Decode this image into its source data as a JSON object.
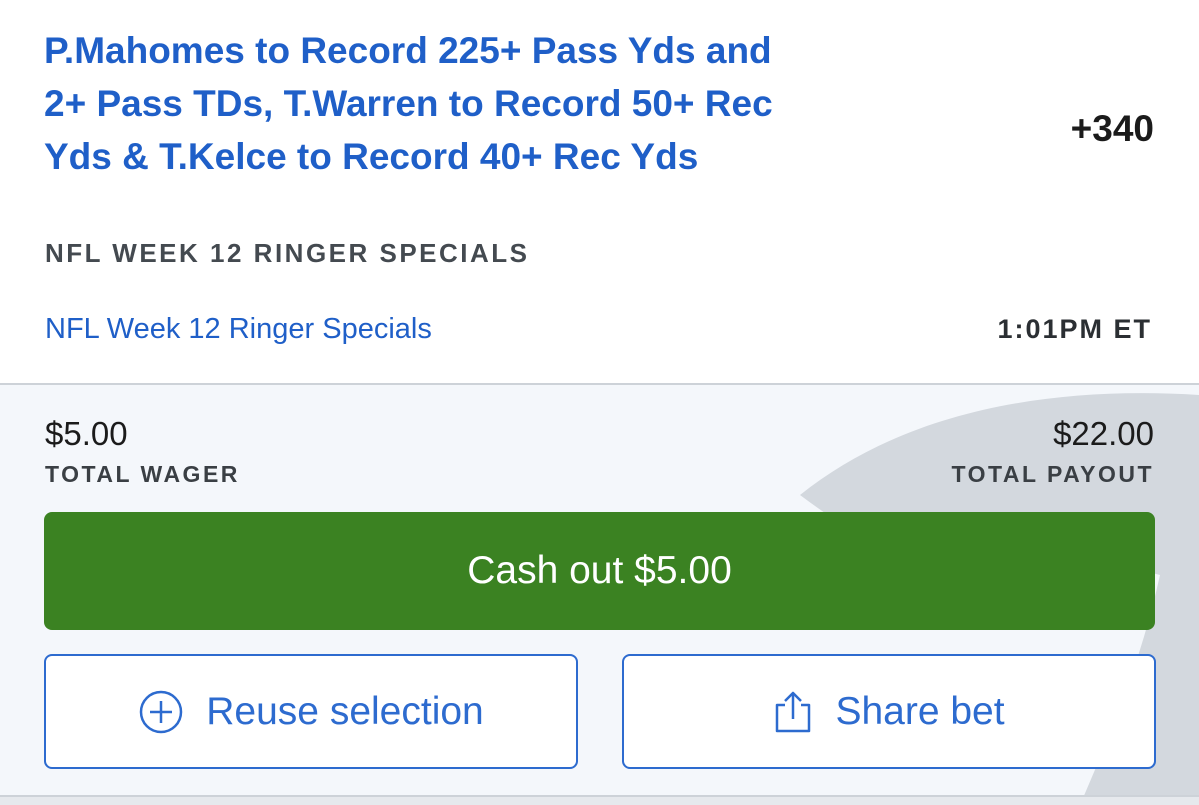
{
  "bet": {
    "title": "P.Mahomes to Record 225+ Pass Yds and 2+ Pass TDs, T.Warren to Record 50+ Rec Yds & T.Kelce to Record 40+ Rec Yds",
    "odds": "+340",
    "market": "NFL WEEK 12 RINGER SPECIALS",
    "event_link": "NFL Week 12 Ringer Specials",
    "event_time": "1:01PM ET"
  },
  "summary": {
    "wager_amount": "$5.00",
    "wager_label": "TOTAL WAGER",
    "payout_amount": "$22.00",
    "payout_label": "TOTAL PAYOUT"
  },
  "actions": {
    "cashout_label": "Cash out $5.00",
    "reuse_label": "Reuse selection",
    "share_label": "Share bet"
  },
  "icons": {
    "reuse": "plus-circle-icon",
    "share": "share-icon",
    "watermark": "shield-logo-icon"
  },
  "colors": {
    "link_blue": "#1f5fc8",
    "cashout_green": "#3b8222",
    "button_border_blue": "#2d6bcf",
    "panel_background": "#f4f7fb"
  }
}
